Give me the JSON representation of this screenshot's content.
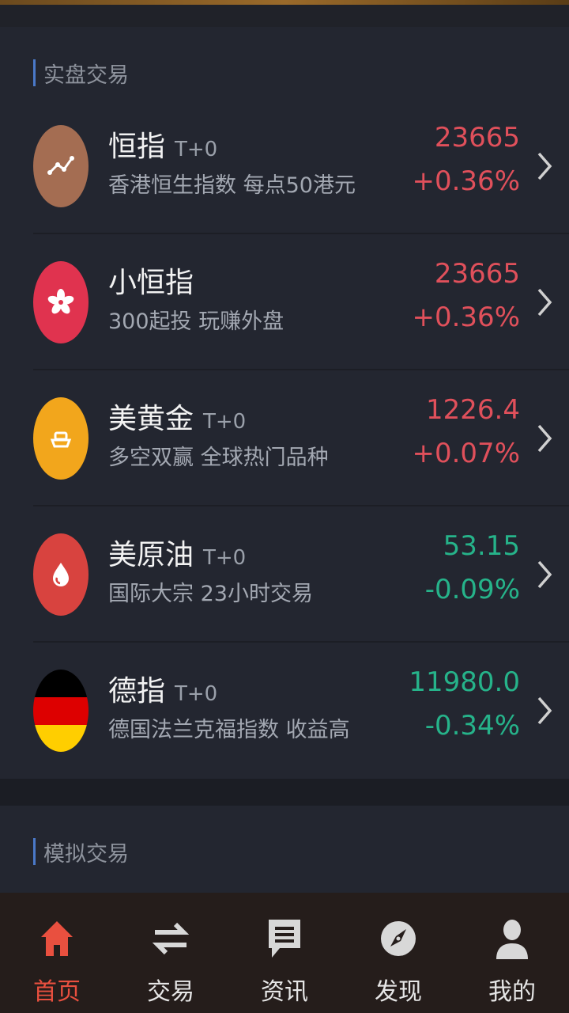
{
  "sections": {
    "real": {
      "title": "实盘交易"
    },
    "simulated": {
      "title": "模拟交易"
    }
  },
  "markets": [
    {
      "name": "恒指",
      "tag": "T+0",
      "desc": "香港恒生指数 每点50港元",
      "price": "23665",
      "change": "+0.36%",
      "trend": "up",
      "icon": "chart-icon",
      "icon_bg": "#a46d52"
    },
    {
      "name": "小恒指",
      "tag": "",
      "desc": "300起投 玩赚外盘",
      "price": "23665",
      "change": "+0.36%",
      "trend": "up",
      "icon": "bauhinia-flower-icon",
      "icon_bg": "#e0334f"
    },
    {
      "name": "美黄金",
      "tag": "T+0",
      "desc": "多空双赢 全球热门品种",
      "price": "1226.4",
      "change": "+0.07%",
      "trend": "up",
      "icon": "gold-ingot-icon",
      "icon_bg": "#f2a61c"
    },
    {
      "name": "美原油",
      "tag": "T+0",
      "desc": "国际大宗 23小时交易",
      "price": "53.15",
      "change": "-0.09%",
      "trend": "down",
      "icon": "oil-drop-icon",
      "icon_bg": "#d8433f"
    },
    {
      "name": "德指",
      "tag": "T+0",
      "desc": "德国法兰克福指数 收益高",
      "price": "11980.0",
      "change": "-0.34%",
      "trend": "down",
      "icon": "germany-flag-icon",
      "icon_bg": "#000000"
    }
  ],
  "colors": {
    "up": "#e0505b",
    "down": "#26b38a",
    "accent": "#e9503f",
    "section_bar": "#4a79c9"
  },
  "tabbar": {
    "items": [
      {
        "label": "首页",
        "icon": "home-icon",
        "active": true
      },
      {
        "label": "交易",
        "icon": "exchange-arrows-icon",
        "active": false
      },
      {
        "label": "资讯",
        "icon": "message-icon",
        "active": false
      },
      {
        "label": "发现",
        "icon": "compass-icon",
        "active": false
      },
      {
        "label": "我的",
        "icon": "user-icon",
        "active": false
      }
    ]
  }
}
